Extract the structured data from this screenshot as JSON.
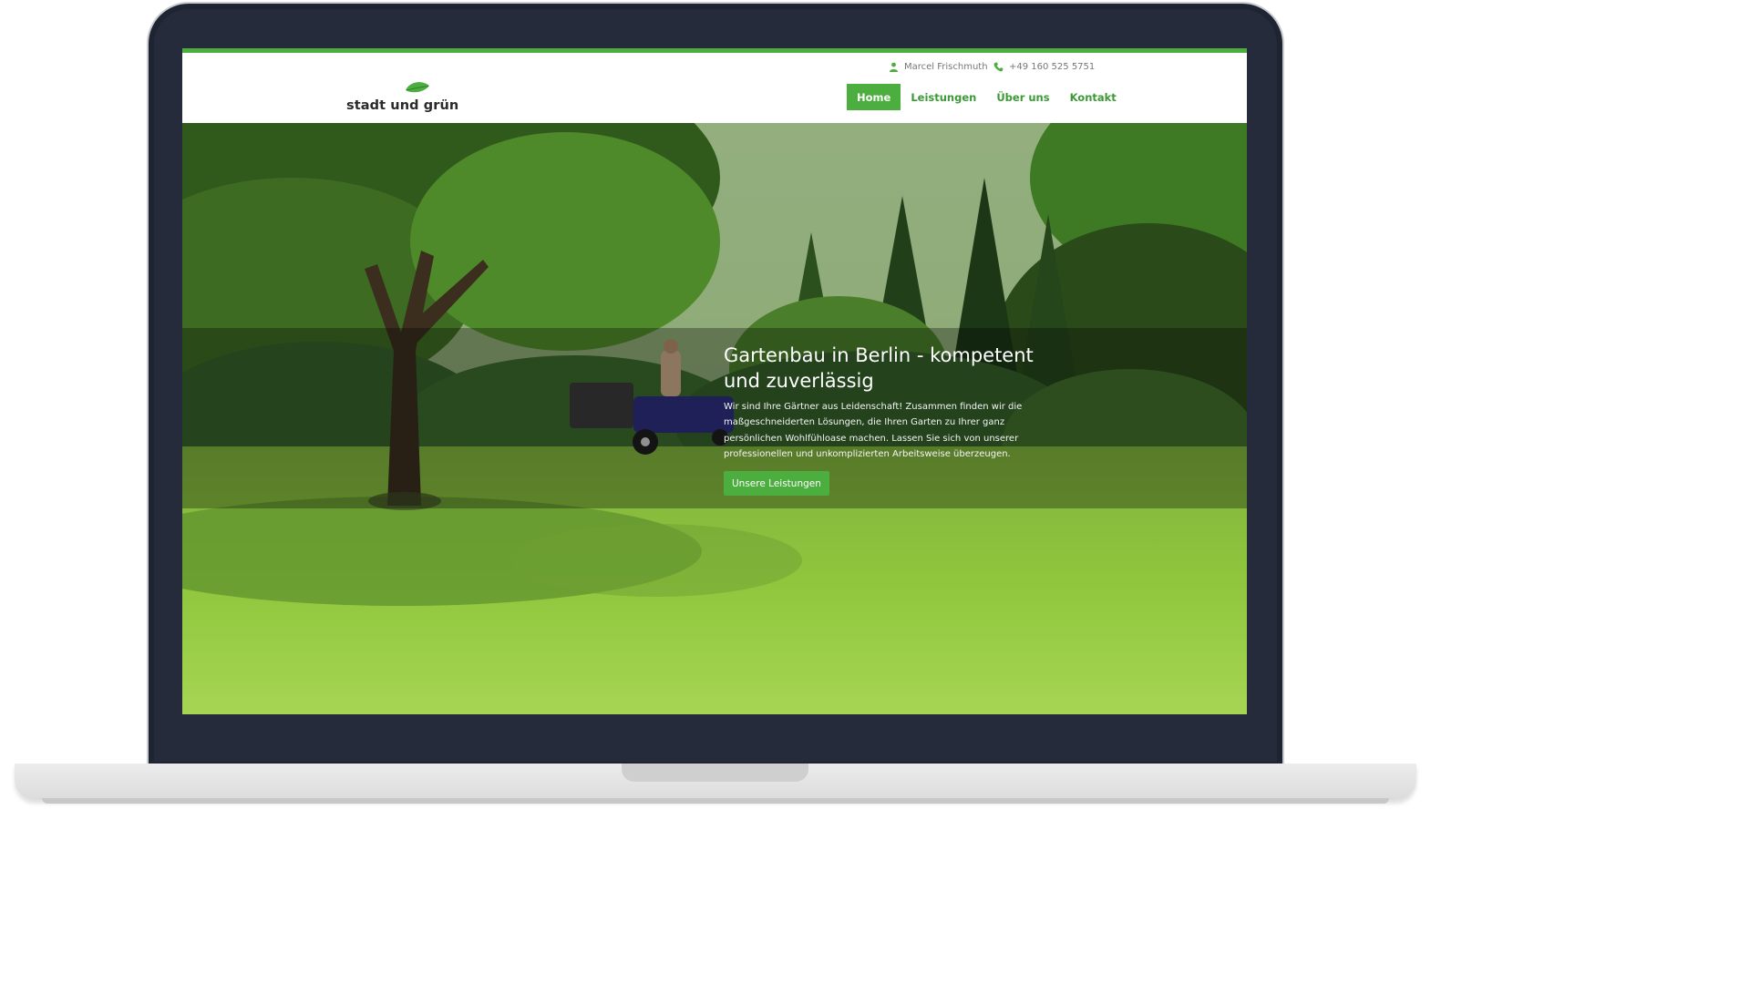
{
  "header": {
    "contact_name": "Marcel Frischmuth",
    "contact_phone": "+49 160 525 5751",
    "logo_text": "stadt und grün",
    "nav": [
      "Home",
      "Leistungen",
      "Über uns",
      "Kontakt"
    ],
    "active_nav": "Home"
  },
  "hero": {
    "title": "Gartenbau in Berlin - kompetent und zuverlässig",
    "text": "Wir sind Ihre Gärtner aus Leidenschaft! Zusammen finden wir die maßgeschneiderten Lösungen, die Ihren Garten zu Ihrer ganz persönlichen Wohlfühloase machen. Lassen Sie sich von unserer professionellen und unkomplizierten Arbeitsweise überzeugen.",
    "button_label": "Unsere Leistungen"
  },
  "colors": {
    "brand_green": "#4cae3f",
    "laptop_frame": "#252b3b"
  },
  "icons": {
    "contact_person": "user-icon",
    "contact_phone": "phone-icon",
    "logo_mark": "leaf-icon"
  }
}
